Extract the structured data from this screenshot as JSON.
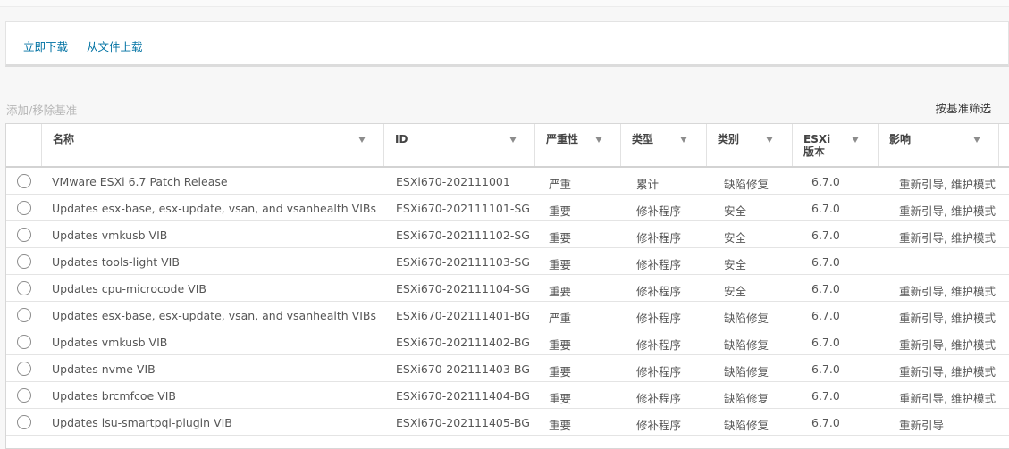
{
  "toolbar": {
    "download_label": "立即下载",
    "upload_label": "从文件上载"
  },
  "add_remove_label": "添加/移除基准",
  "filter_label": "按基准筛选",
  "columns": {
    "name": "名称",
    "id": "ID",
    "severity": "严重性",
    "type": "类型",
    "category": "类别",
    "esxi_version": "ESXi 版本",
    "impact": "影响"
  },
  "rows": [
    {
      "name": "VMware ESXi 6.7 Patch Release",
      "id": "ESXi670-202111001",
      "severity": "严重",
      "type": "累计",
      "category": "缺陷修复",
      "version": "6.7.0",
      "impact": "重新引导, 维护模式"
    },
    {
      "name": "Updates esx-base, esx-update, vsan, and vsanhealth VIBs",
      "id": "ESXi670-202111101-SG",
      "severity": "重要",
      "type": "修补程序",
      "category": "安全",
      "version": "6.7.0",
      "impact": "重新引导, 维护模式"
    },
    {
      "name": "Updates vmkusb VIB",
      "id": "ESXi670-202111102-SG",
      "severity": "重要",
      "type": "修补程序",
      "category": "安全",
      "version": "6.7.0",
      "impact": "重新引导, 维护模式"
    },
    {
      "name": "Updates tools-light VIB",
      "id": "ESXi670-202111103-SG",
      "severity": "重要",
      "type": "修补程序",
      "category": "安全",
      "version": "6.7.0",
      "impact": ""
    },
    {
      "name": "Updates cpu-microcode VIB",
      "id": "ESXi670-202111104-SG",
      "severity": "重要",
      "type": "修补程序",
      "category": "安全",
      "version": "6.7.0",
      "impact": "重新引导, 维护模式"
    },
    {
      "name": "Updates esx-base, esx-update, vsan, and vsanhealth VIBs",
      "id": "ESXi670-202111401-BG",
      "severity": "严重",
      "type": "修补程序",
      "category": "缺陷修复",
      "version": "6.7.0",
      "impact": "重新引导, 维护模式"
    },
    {
      "name": "Updates vmkusb VIB",
      "id": "ESXi670-202111402-BG",
      "severity": "重要",
      "type": "修补程序",
      "category": "缺陷修复",
      "version": "6.7.0",
      "impact": "重新引导, 维护模式"
    },
    {
      "name": "Updates nvme VIB",
      "id": "ESXi670-202111403-BG",
      "severity": "重要",
      "type": "修补程序",
      "category": "缺陷修复",
      "version": "6.7.0",
      "impact": "重新引导, 维护模式"
    },
    {
      "name": "Updates brcmfcoe VIB",
      "id": "ESXi670-202111404-BG",
      "severity": "重要",
      "type": "修补程序",
      "category": "缺陷修复",
      "version": "6.7.0",
      "impact": "重新引导, 维护模式"
    },
    {
      "name": "Updates lsu-smartpqi-plugin VIB",
      "id": "ESXi670-202111405-BG",
      "severity": "重要",
      "type": "修补程序",
      "category": "缺陷修复",
      "version": "6.7.0",
      "impact": "重新引导"
    }
  ]
}
